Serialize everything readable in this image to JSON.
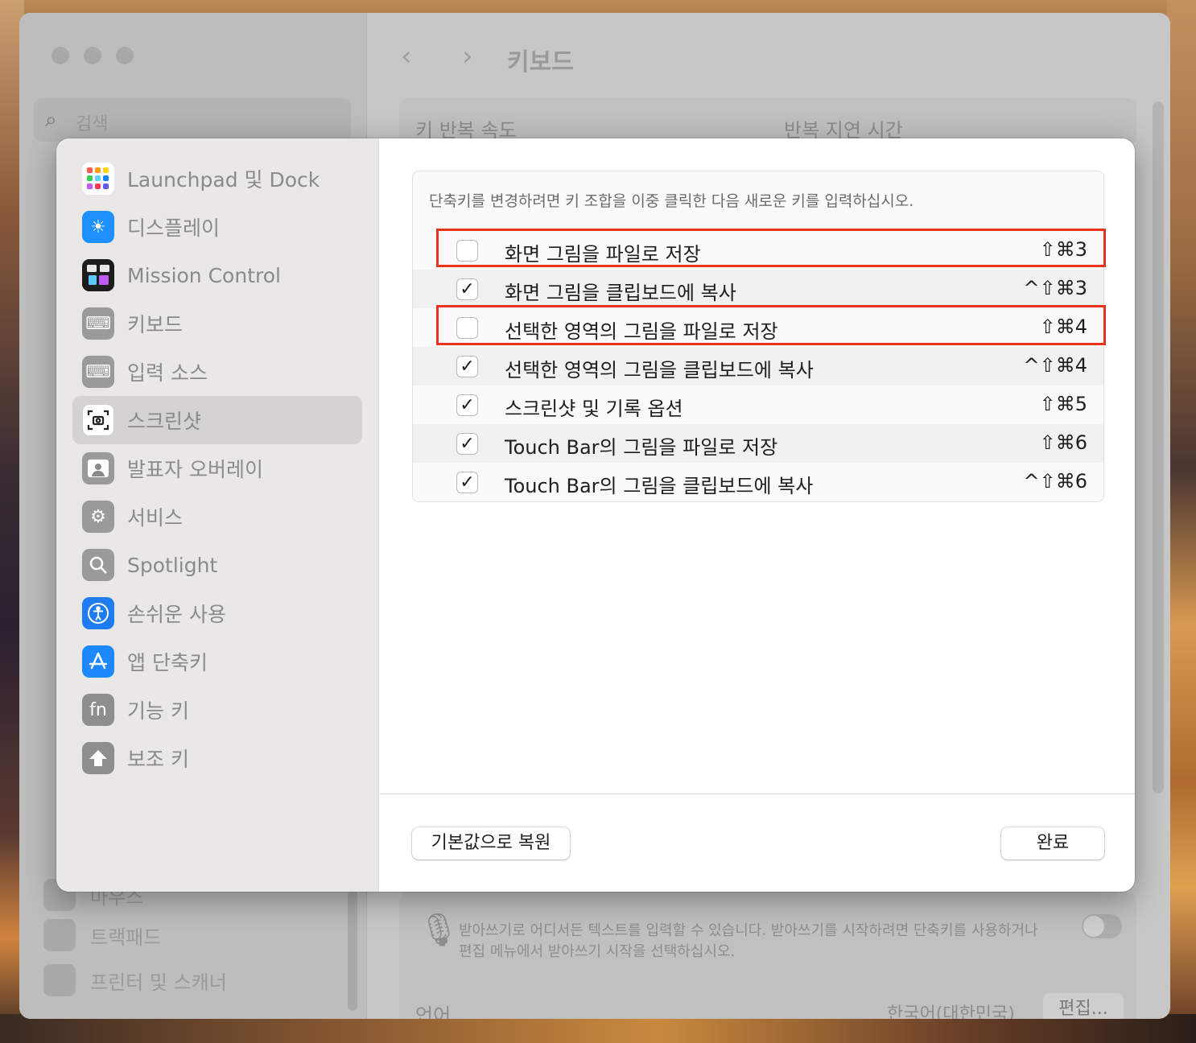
{
  "background_window": {
    "title": "키보드",
    "search_placeholder": "검색",
    "key_repeat_label": "키 반복 속도",
    "repeat_delay_label": "반복 지연 시간",
    "dictation_text_line1": "받아쓰기로 어디서든 텍스트를 입력할 수 있습니다. 받아쓰기를 시작하려면 단축키를 사용하거나",
    "dictation_text_line2": "편집 메뉴에서 받아쓰기 시작을 선택하십시오.",
    "language_label": "언어",
    "language_value": "한국어(대한민국)",
    "edit_button": "편집...",
    "sidebar_items": [
      "마우스",
      "트랙패드",
      "프린터 및 스캐너"
    ]
  },
  "sheet": {
    "sidebar": {
      "items": [
        {
          "label": "Launchpad 및 Dock",
          "icon": "launchpad-icon",
          "color": "#ffffff",
          "selected": false
        },
        {
          "label": "디스플레이",
          "icon": "sun-icon",
          "color": "#1e90ff",
          "selected": false
        },
        {
          "label": "Mission Control",
          "icon": "mission-control-icon",
          "color": "#1c1c1c",
          "selected": false
        },
        {
          "label": "키보드",
          "icon": "keyboard-icon",
          "color": "#9a9a9a",
          "selected": false
        },
        {
          "label": "입력 소스",
          "icon": "keyboard-icon",
          "color": "#9a9a9a",
          "selected": false
        },
        {
          "label": "스크린샷",
          "icon": "screenshot-icon",
          "color": "#ffffff",
          "selected": true
        },
        {
          "label": "발표자 오버레이",
          "icon": "presenter-icon",
          "color": "#9a9a9a",
          "selected": false
        },
        {
          "label": "서비스",
          "icon": "gears-icon",
          "color": "#9a9a9a",
          "selected": false
        },
        {
          "label": "Spotlight",
          "icon": "magnifier-icon",
          "color": "#9a9a9a",
          "selected": false
        },
        {
          "label": "손쉬운 사용",
          "icon": "accessibility-icon",
          "color": "#1e7cf0",
          "selected": false
        },
        {
          "label": "앱 단축키",
          "icon": "app-store-icon",
          "color": "#1e88ff",
          "selected": false
        },
        {
          "label": "기능 키",
          "icon": "fn-icon",
          "color": "#8e8e8e",
          "selected": false
        },
        {
          "label": "보조 키",
          "icon": "arrow-up-icon",
          "color": "#8e8e8e",
          "selected": false
        }
      ]
    },
    "instruction": "단축키를 변경하려면 키 조합을 이중 클릭한 다음 새로운 키를 입력하십시오.",
    "shortcuts": [
      {
        "label": "화면 그림을 파일로 저장",
        "keys": "⇧⌘3",
        "checked": false,
        "highlighted": true
      },
      {
        "label": "화면 그림을 클립보드에 복사",
        "keys": "^⇧⌘3",
        "checked": true,
        "highlighted": false
      },
      {
        "label": "선택한 영역의 그림을 파일로 저장",
        "keys": "⇧⌘4",
        "checked": false,
        "highlighted": true
      },
      {
        "label": "선택한 영역의 그림을 클립보드에 복사",
        "keys": "^⇧⌘4",
        "checked": true,
        "highlighted": false
      },
      {
        "label": "스크린샷 및 기록 옵션",
        "keys": "⇧⌘5",
        "checked": true,
        "highlighted": false
      },
      {
        "label": "Touch Bar의 그림을 파일로 저장",
        "keys": "⇧⌘6",
        "checked": true,
        "highlighted": false
      },
      {
        "label": "Touch Bar의 그림을 클립보드에 복사",
        "keys": "^⇧⌘6",
        "checked": true,
        "highlighted": false
      }
    ],
    "restore_defaults_button": "기본값으로 복원",
    "done_button": "완료"
  },
  "colors": {
    "highlight": "#e8321e",
    "selected_sidebar": "#d4d3d2"
  }
}
